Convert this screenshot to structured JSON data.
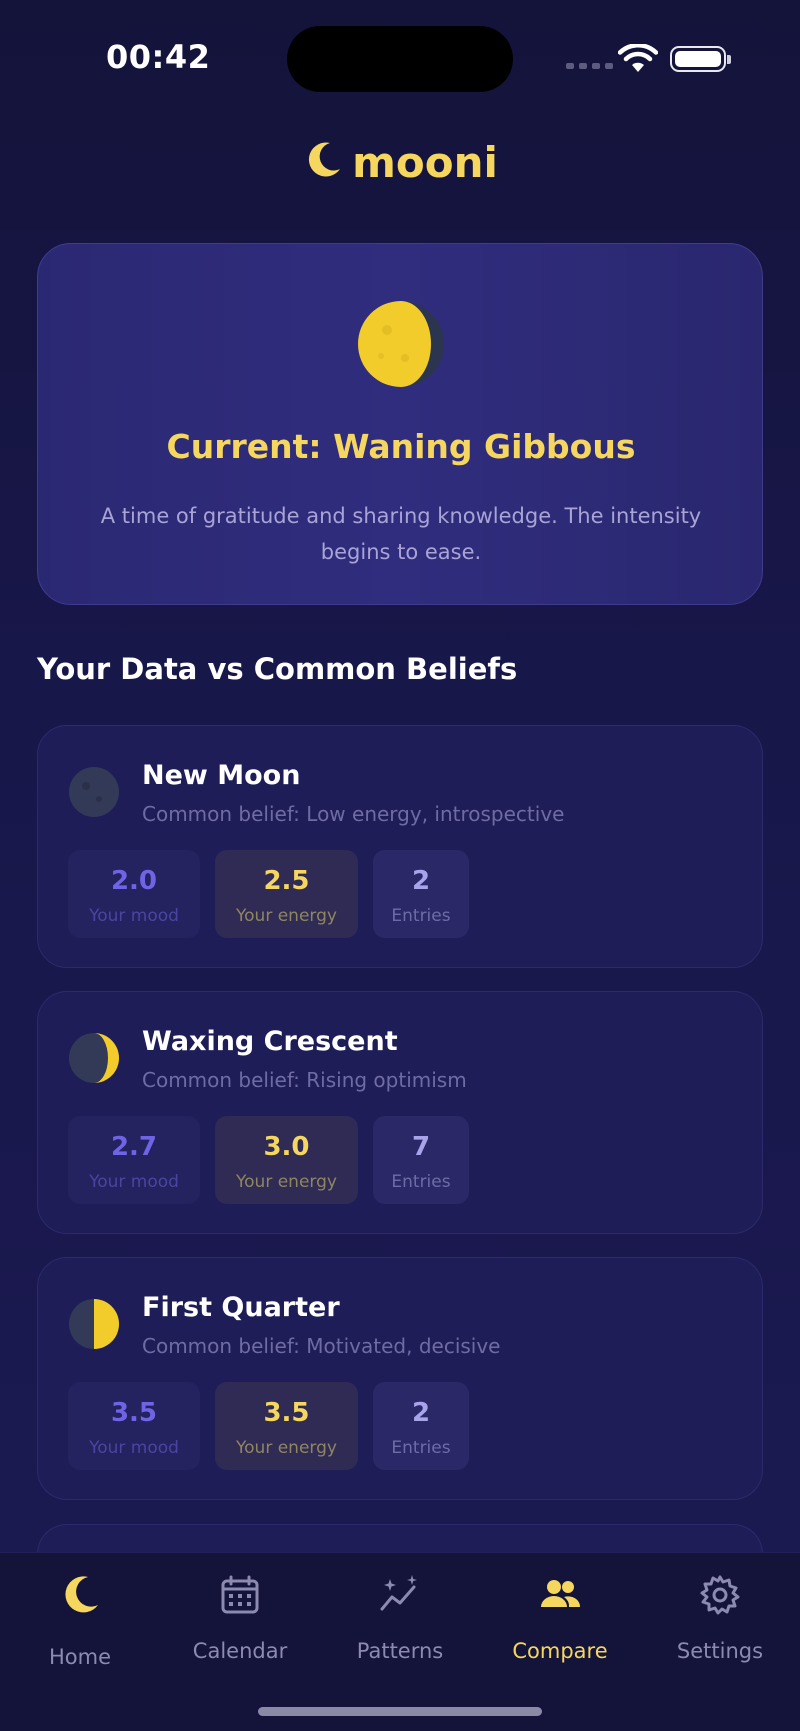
{
  "status_bar": {
    "time": "00:42"
  },
  "app": {
    "title": "mooni"
  },
  "current_phase": {
    "title": "Current: Waning Gibbous",
    "description": "A time of gratitude and sharing knowledge. The intensity begins to ease."
  },
  "section": {
    "title": "Your Data vs Common Beliefs"
  },
  "phases": [
    {
      "name": "New Moon",
      "belief": "Common belief: Low energy, introspective",
      "mood": "2.0",
      "mood_label": "Your mood",
      "energy": "2.5",
      "energy_label": "Your energy",
      "entries": "2",
      "entries_label": "Entries"
    },
    {
      "name": "Waxing Crescent",
      "belief": "Common belief: Rising optimism",
      "mood": "2.7",
      "mood_label": "Your mood",
      "energy": "3.0",
      "energy_label": "Your energy",
      "entries": "7",
      "entries_label": "Entries"
    },
    {
      "name": "First Quarter",
      "belief": "Common belief: Motivated, decisive",
      "mood": "3.5",
      "mood_label": "Your mood",
      "energy": "3.5",
      "energy_label": "Your energy",
      "entries": "2",
      "entries_label": "Entries"
    }
  ],
  "tabs": [
    {
      "label": "Home",
      "icon": "crescent-moon-icon",
      "active": false
    },
    {
      "label": "Calendar",
      "icon": "calendar-icon",
      "active": false
    },
    {
      "label": "Patterns",
      "icon": "sparkle-chart-icon",
      "active": false
    },
    {
      "label": "Compare",
      "icon": "people-icon",
      "active": true
    },
    {
      "label": "Settings",
      "icon": "gear-icon",
      "active": false
    }
  ],
  "colors": {
    "accent": "#f5d65e",
    "background": "#161540",
    "card": "#1f1d57",
    "mood": "#6f63e6"
  }
}
